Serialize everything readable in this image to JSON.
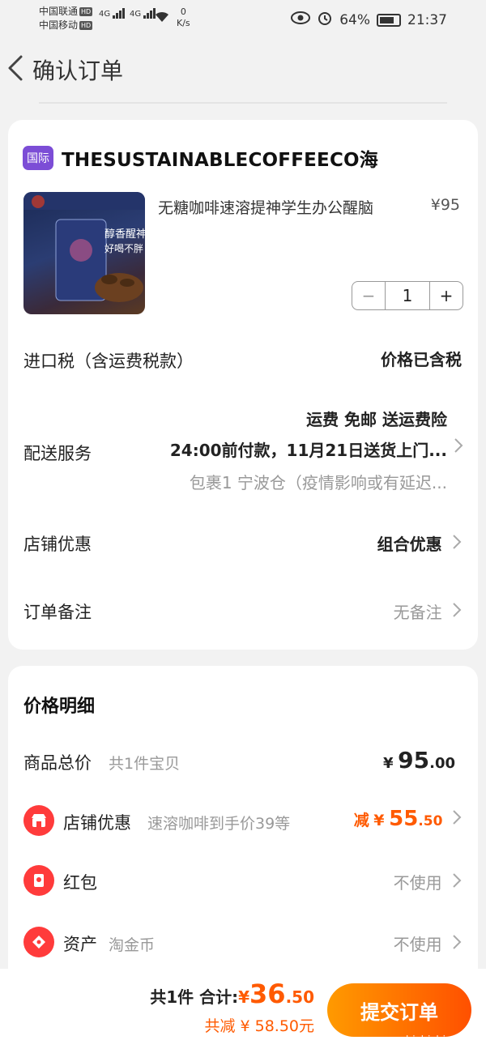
{
  "status_bar": {
    "carrier1": "中国联通",
    "carrier2": "中国移动",
    "hd": "HD",
    "net": "4G",
    "speed_value": "0",
    "speed_unit": "K/s",
    "battery": "64%",
    "time": "21:37"
  },
  "header": {
    "title": "确认订单"
  },
  "store": {
    "badge": "国际",
    "name": "THESUSTAINABLECOFFEECO海"
  },
  "product": {
    "title": "无糖咖啡速溶提神学生办公醒脑",
    "price": "¥95",
    "quantity": "1",
    "minus": "−",
    "plus": "+",
    "image_text": "醇香醒神",
    "image_text2": "好喝不胖"
  },
  "import_tax": {
    "label": "进口税（含运费税款）",
    "value": "价格已含税"
  },
  "delivery": {
    "label": "配送服务",
    "line1": "运费 免邮 送运费险",
    "line2": "24:00前付款，11月21日送货上门...",
    "line3": "包裹1 宁波仓（疫情影响或有延迟..."
  },
  "store_discount": {
    "label": "店铺优惠",
    "value": "组合优惠"
  },
  "order_note": {
    "label": "订单备注",
    "value": "无备注"
  },
  "price_detail": {
    "title": "价格明细",
    "goods_total_label": "商品总价",
    "goods_total_sub": "共1件宝贝",
    "goods_total_cur": "¥",
    "goods_total_int": "95",
    "goods_total_dec": ".00",
    "shop_discount_label": "店铺优惠",
    "shop_discount_sub": "速溶咖啡到手价39等",
    "shop_discount_prefix": "减",
    "shop_discount_cur": "¥",
    "shop_discount_int": "55",
    "shop_discount_dec": ".50",
    "redpacket_label": "红包",
    "redpacket_value": "不使用",
    "assets_label": "资产",
    "assets_sub": "淘金币",
    "assets_value": "不使用"
  },
  "bottom": {
    "count": "共1件",
    "total_label": "合计:",
    "total_cur": "¥",
    "total_int": "36",
    "total_dec": ".50",
    "saved": "共减 ¥ 58.50元",
    "submit": "提交订单",
    "watermark": "zhizhizhi.com"
  }
}
